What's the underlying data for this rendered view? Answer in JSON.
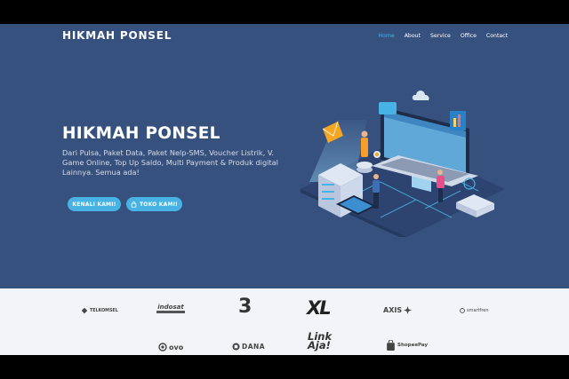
{
  "nav": {
    "brand": "HIKMAH PONSEL",
    "items": [
      {
        "label": "Home",
        "active": true
      },
      {
        "label": "About",
        "active": false
      },
      {
        "label": "Service",
        "active": false
      },
      {
        "label": "Office",
        "active": false
      },
      {
        "label": "Contact",
        "active": false
      }
    ]
  },
  "hero": {
    "title": "HIKMAH PONSEL",
    "description": "Dari Pulsa, Paket Data, Paket Nelp-SMS, Voucher Listrik, V. Game Online, Top Up Saldo, Multi Payment & Produk digital Lainnya. Semua ada!",
    "primary_button": "KENALI KAMI!",
    "secondary_button": "TOKO KAMI!",
    "secondary_icon": "shopping-bag-icon",
    "illustration": "isometric-tech-illustration"
  },
  "clients": {
    "row1": [
      "TELKOMSEL",
      "indosat",
      "3",
      "XL",
      "AXIS",
      "smartfren"
    ],
    "row2": [
      "ovo",
      "DANA",
      "Link Aja!",
      "ShopeePay"
    ]
  },
  "colors": {
    "hero_bg": "#37517e",
    "accent": "#47b2e4",
    "clients_bg": "#f3f4f7"
  }
}
